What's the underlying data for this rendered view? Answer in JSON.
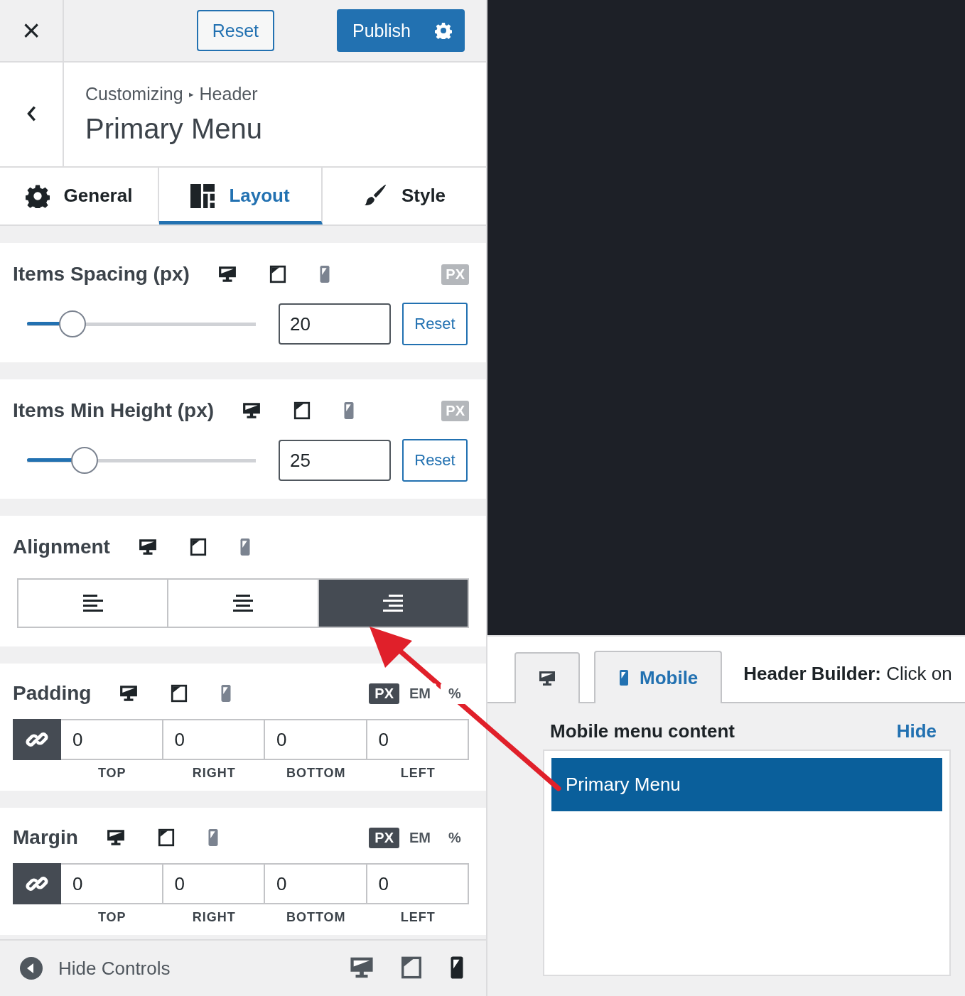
{
  "topbar": {
    "close": "×",
    "reset": "Reset",
    "publish": "Publish"
  },
  "title": {
    "breadcrumb": "Customizing",
    "separator": "▸",
    "parent": "Header",
    "heading": "Primary Menu"
  },
  "tabs": [
    {
      "label": "General",
      "selected": false
    },
    {
      "label": "Layout",
      "selected": true
    },
    {
      "label": "Style",
      "selected": false
    }
  ],
  "sections": [
    {
      "kind": "slider",
      "label": "Items Spacing (px)",
      "unit": "PX",
      "level": 0.2,
      "value": "20",
      "reset": "Reset"
    },
    {
      "kind": "slider",
      "label": "Items Min Height (px)",
      "unit": "PX",
      "level": 0.25,
      "value": "25",
      "reset": "Reset"
    },
    {
      "kind": "align",
      "label": "Alignment",
      "options": [
        {
          "kind": "left",
          "selected": false
        },
        {
          "kind": "center",
          "selected": false
        },
        {
          "kind": "right",
          "selected": true
        }
      ]
    },
    {
      "kind": "spacing",
      "label": "Padding",
      "units": [
        {
          "label": "PX",
          "selected": true
        },
        {
          "label": "EM",
          "selected": false
        },
        {
          "label": "%",
          "selected": false
        }
      ],
      "linked": true,
      "fields": [
        {
          "value": "0",
          "label": "TOP"
        },
        {
          "value": "0",
          "label": "RIGHT"
        },
        {
          "value": "0",
          "label": "BOTTOM"
        },
        {
          "value": "0",
          "label": "LEFT"
        }
      ]
    },
    {
      "kind": "spacing",
      "label": "Margin",
      "units": [
        {
          "label": "PX",
          "selected": true
        },
        {
          "label": "EM",
          "selected": false
        },
        {
          "label": "%",
          "selected": false
        }
      ],
      "linked": true,
      "fields": [
        {
          "value": "0",
          "label": "TOP"
        },
        {
          "value": "0",
          "label": "RIGHT"
        },
        {
          "value": "0",
          "label": "BOTTOM"
        },
        {
          "value": "0",
          "label": "LEFT"
        }
      ]
    }
  ],
  "footer": {
    "hide_controls": "Hide Controls",
    "devices": [
      {
        "kind": "desktop",
        "selected": false
      },
      {
        "kind": "tablet",
        "selected": false
      },
      {
        "kind": "mobile",
        "selected": true
      }
    ]
  },
  "builder": {
    "tabs": [
      {
        "kind": "desktop",
        "selected": false
      },
      {
        "kind": "mobile",
        "label": "Mobile",
        "selected": true
      }
    ],
    "notice": "**Header Builder:** Click on",
    "panel_title": "Mobile menu content",
    "hide": "Hide",
    "items": [
      "Primary Menu"
    ]
  }
}
